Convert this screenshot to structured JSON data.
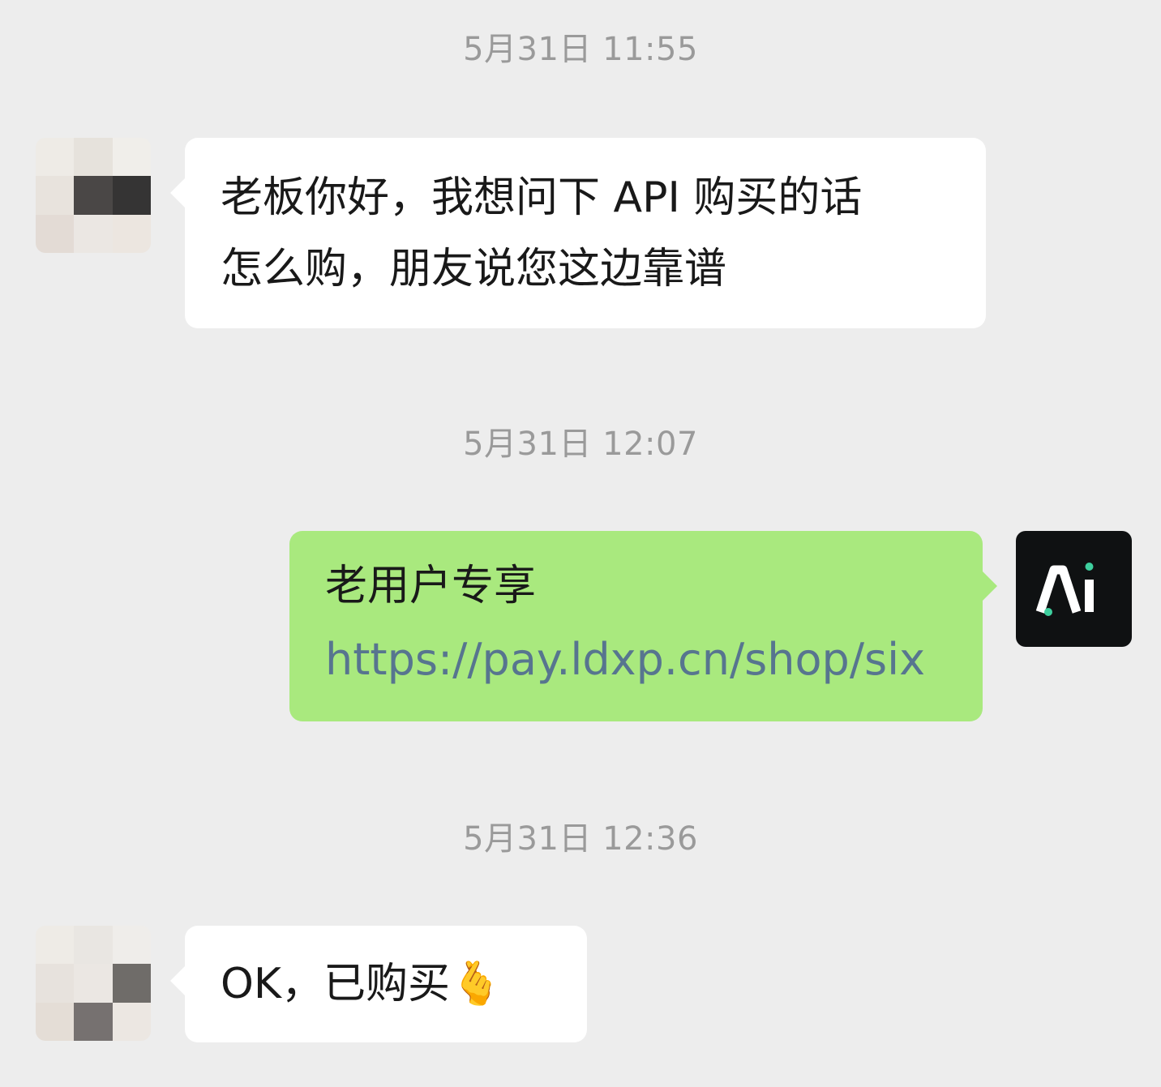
{
  "messages": [
    {
      "timestamp": "5月31日 11:55",
      "sender": "contact",
      "text": "老板你好，我想问下 API 购买的话\n怎么购，朋友说您这边靠谱"
    },
    {
      "timestamp": "5月31日 12:07",
      "sender": "self",
      "text": "老用户专享",
      "link": "https://pay.ldxp.cn/shop/six"
    },
    {
      "timestamp": "5月31日 12:36",
      "sender": "contact",
      "text": "OK，已购买🫰"
    }
  ],
  "avatars": {
    "contact": "pixelated-avatar",
    "self": "ai-logo-avatar",
    "self_logo_text": "Ai"
  },
  "colors": {
    "background": "#ededed",
    "incoming_bubble": "#ffffff",
    "outgoing_bubble": "#a9e97e",
    "link": "#57758f",
    "timestamp": "#9a9a9a",
    "ai_avatar_bg": "#0f1112",
    "ai_dot": "#3ecf9e"
  }
}
